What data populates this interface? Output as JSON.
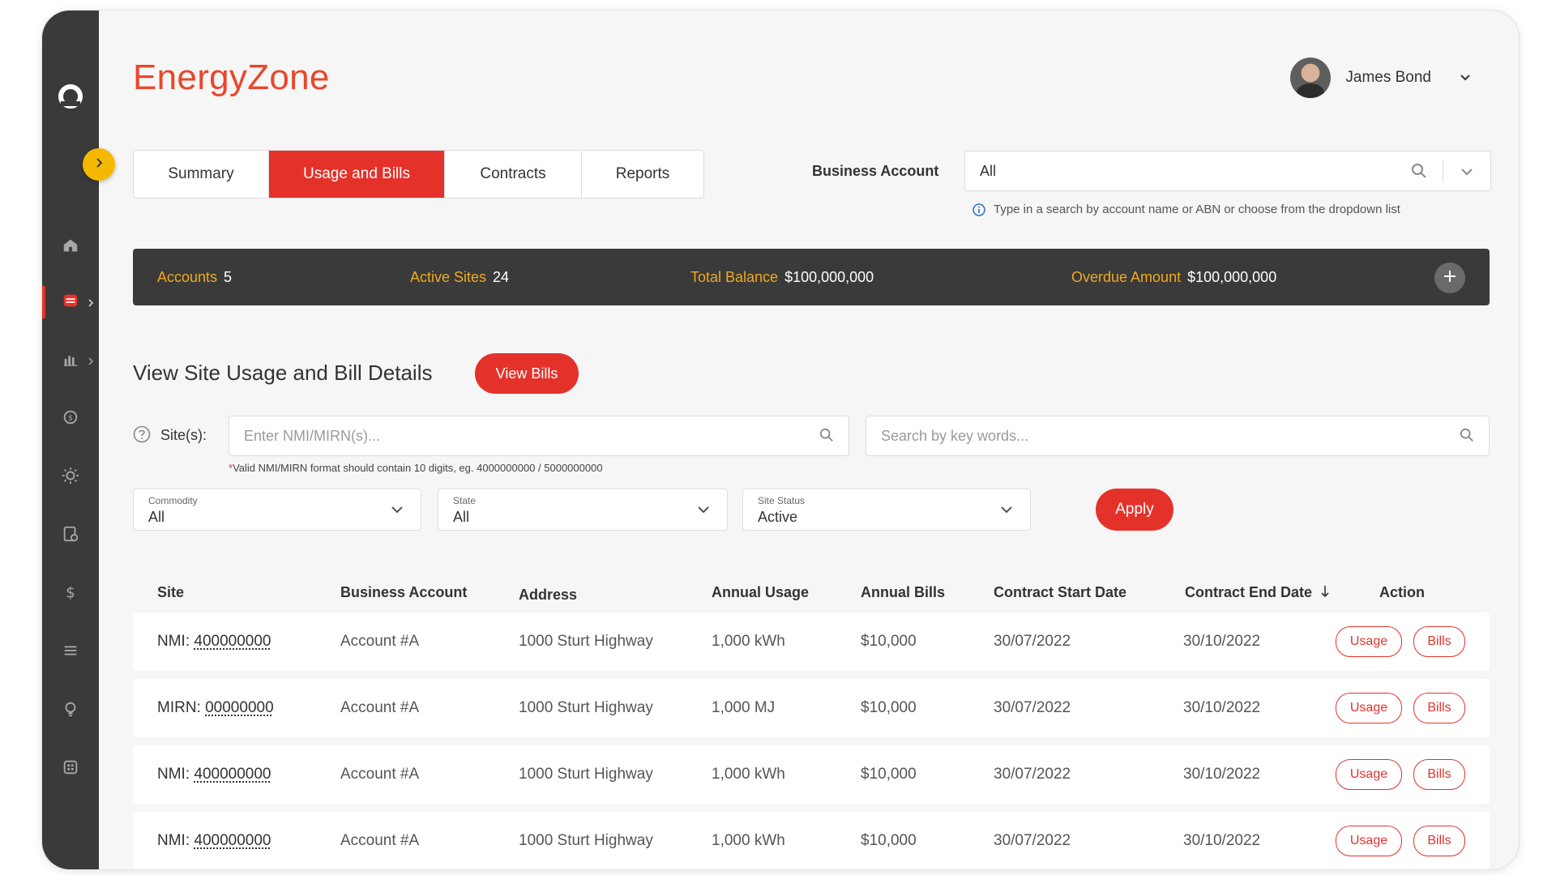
{
  "app": {
    "brand": "EnergyZone"
  },
  "user": {
    "name": "James Bond"
  },
  "tabs": [
    {
      "label": "Summary",
      "active": false
    },
    {
      "label": "Usage and Bills",
      "active": true
    },
    {
      "label": "Contracts",
      "active": false
    },
    {
      "label": "Reports",
      "active": false
    }
  ],
  "business_account": {
    "label": "Business Account",
    "value": "All",
    "hint": "Type in a search by account name or ABN or choose from the dropdown list"
  },
  "stats": {
    "accounts": {
      "label": "Accounts",
      "value": "5"
    },
    "active_sites": {
      "label": "Active Sites",
      "value": "24"
    },
    "total_balance": {
      "label": "Total Balance",
      "value": "$100,000,000"
    },
    "overdue_amount": {
      "label": "Overdue Amount",
      "value": "$100,000,000"
    }
  },
  "section": {
    "title": "View Site Usage and Bill Details",
    "view_bills_label": "View Bills"
  },
  "filters": {
    "sites_label": "Site(s):",
    "nmi_placeholder": "Enter NMI/MIRN(s)...",
    "keyword_placeholder": "Search by key words...",
    "nmi_note_star": "*",
    "nmi_note": "Valid NMI/MIRN format should contain 10 digits, eg. 4000000000 / 5000000000",
    "commodity": {
      "label": "Commodity",
      "value": "All"
    },
    "state": {
      "label": "State",
      "value": "All"
    },
    "site_status": {
      "label": "Site Status",
      "value": "Active"
    },
    "apply_label": "Apply"
  },
  "table": {
    "headers": {
      "site": "Site",
      "business_account": "Business Account",
      "address": "Address",
      "annual_usage": "Annual Usage",
      "annual_bills": "Annual Bills",
      "contract_start": "Contract Start Date",
      "contract_end": "Contract End Date",
      "action": "Action"
    },
    "sort": {
      "column": "Contract End Date",
      "direction": "descending"
    },
    "rows": [
      {
        "type": "NMI:",
        "id": "400000000",
        "account": "Account #A",
        "address": "1000 Sturt Highway",
        "usage": "1,000 kWh",
        "bills": "$10,000",
        "start": "30/07/2022",
        "end": "30/10/2022",
        "usage_btn": "Usage",
        "bills_btn": "Bills"
      },
      {
        "type": "MIRN:",
        "id": "00000000",
        "account": "Account #A",
        "address": "1000 Sturt Highway",
        "usage": "1,000 MJ",
        "bills": "$10,000",
        "start": "30/07/2022",
        "end": "30/10/2022",
        "usage_btn": "Usage",
        "bills_btn": "Bills"
      },
      {
        "type": "NMI:",
        "id": "400000000",
        "account": "Account #A",
        "address": "1000 Sturt Highway",
        "usage": "1,000 kWh",
        "bills": "$10,000",
        "start": "30/07/2022",
        "end": "30/10/2022",
        "usage_btn": "Usage",
        "bills_btn": "Bills"
      },
      {
        "type": "NMI:",
        "id": "400000000",
        "account": "Account #A",
        "address": "1000 Sturt Highway",
        "usage": "1,000 kWh",
        "bills": "$10,000",
        "start": "30/07/2022",
        "end": "30/10/2022",
        "usage_btn": "Usage",
        "bills_btn": "Bills"
      }
    ]
  },
  "sidebar": {
    "icons": [
      "logo-icon",
      "expand-icon",
      "home-icon",
      "billing-icon",
      "chart-icon",
      "cycle-icon",
      "sun-icon",
      "document-icon",
      "dollar-icon",
      "menu-icon",
      "bulb-icon",
      "grid-icon"
    ]
  },
  "colors": {
    "accent": "#e4322b",
    "brand": "#e8472c",
    "highlight": "#f0a91c",
    "sidebar": "#3a3a3a",
    "toggle": "#f5b800"
  }
}
